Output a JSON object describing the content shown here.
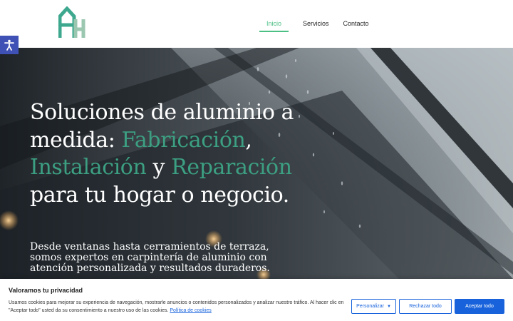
{
  "header": {
    "logo_alt": "AH",
    "nav": [
      {
        "label": "Inicio",
        "active": true
      },
      {
        "label": "Servicios",
        "active": false
      },
      {
        "label": "Contacto",
        "active": false
      }
    ]
  },
  "accessibility": {
    "icon": "accessibility-icon"
  },
  "hero": {
    "title_part1": "Soluciones de aluminio a medida: ",
    "title_hl1": "Fabricación",
    "title_part2": ", ",
    "title_hl2": "Instalación",
    "title_part3": " y ",
    "title_hl3": "Reparación",
    "title_part4": " para tu hogar o negocio.",
    "subtitle": "Desde ventanas hasta cerramientos de terraza, somos expertos en carpintería de aluminio con atención personalizada y resultados duraderos."
  },
  "cookie": {
    "title": "Valoramos tu privacidad",
    "text": "Usamos cookies para mejorar su experiencia de navegación, mostrarle anuncios o contenidos personalizados y analizar nuestro tráfico. Al hacer clic en \"Aceptar todo\" usted da su consentimiento a nuestro uso de las cookies.",
    "link": "Política de cookies",
    "customize_label": "Personalizar",
    "reject_label": "Rechazar todo",
    "accept_label": "Aceptar todo"
  },
  "colors": {
    "accent": "#4bbf84",
    "highlight": "#3c9f82",
    "button_blue": "#1863dc",
    "a11y_bg": "#3f51b5"
  }
}
